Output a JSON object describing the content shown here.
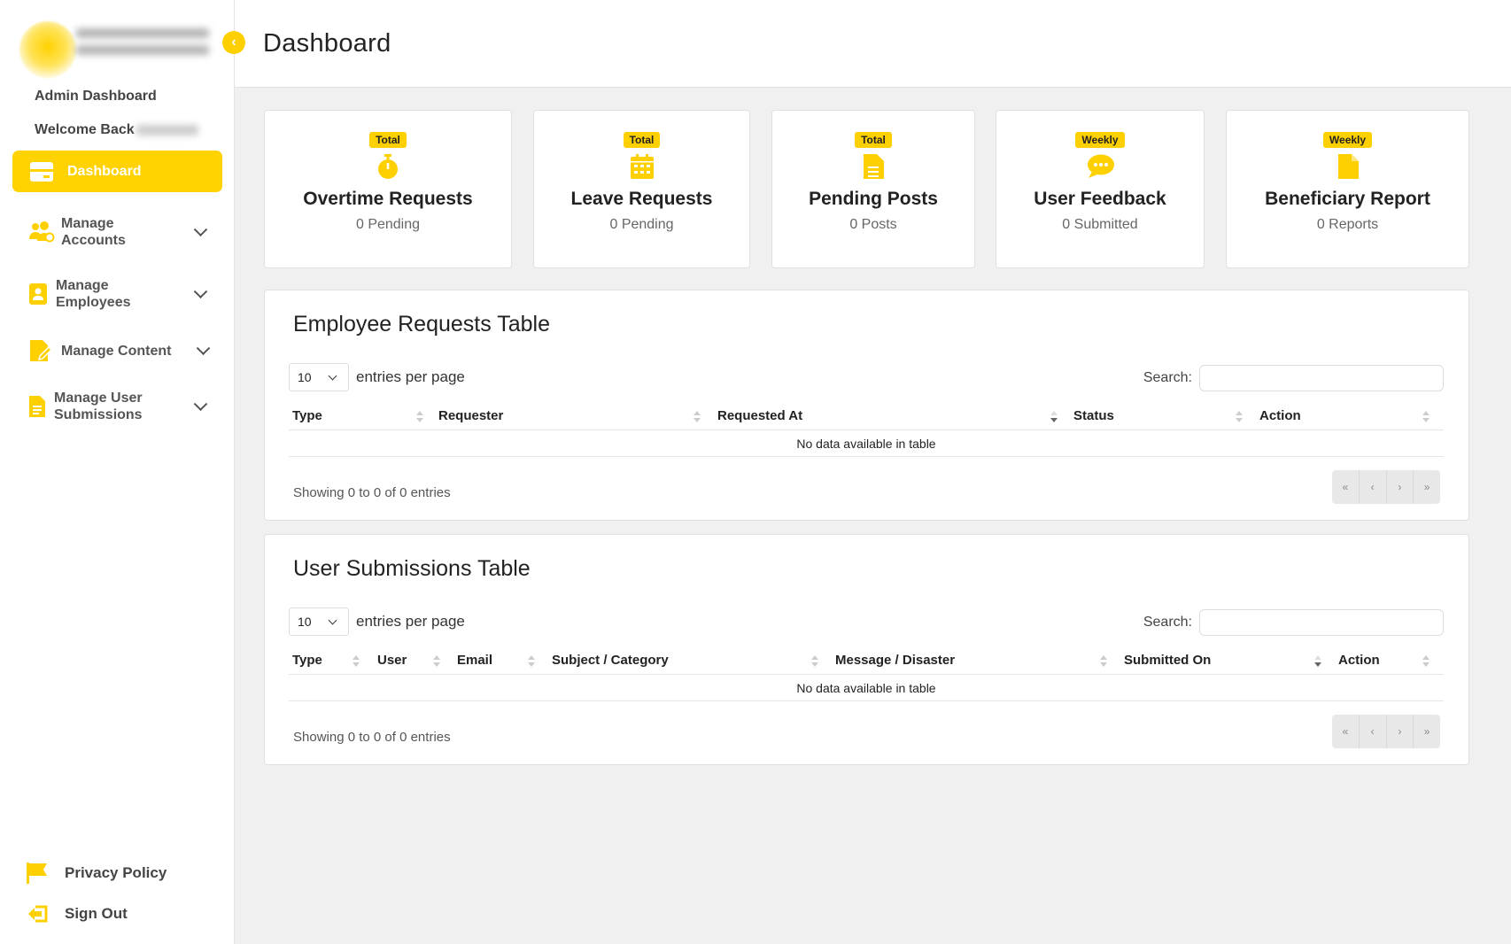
{
  "sidebar": {
    "admin_title": "Admin Dashboard",
    "welcome": "Welcome Back",
    "active_item": "Dashboard",
    "items": [
      {
        "label": "Manage Accounts",
        "icon": "users-icon"
      },
      {
        "label": "Manage Employees",
        "icon": "employee-badge-icon"
      },
      {
        "label": "Manage Content",
        "icon": "edit-document-icon"
      },
      {
        "label": "Manage User Submissions",
        "icon": "submissions-icon"
      }
    ],
    "bottom": {
      "privacy": "Privacy Policy",
      "signout": "Sign Out"
    }
  },
  "header": {
    "title": "Dashboard"
  },
  "cards": [
    {
      "badge": "Total",
      "title": "Overtime Requests",
      "sub": "0 Pending",
      "icon": "stopwatch-icon"
    },
    {
      "badge": "Total",
      "title": "Leave Requests",
      "sub": "0 Pending",
      "icon": "calendar-icon"
    },
    {
      "badge": "Total",
      "title": "Pending Posts",
      "sub": "0 Posts",
      "icon": "document-icon"
    },
    {
      "badge": "Weekly",
      "title": "User Feedback",
      "sub": "0 Submitted",
      "icon": "chat-bubble-icon"
    },
    {
      "badge": "Weekly",
      "title": "Beneficiary Report",
      "sub": "0 Reports",
      "icon": "file-icon"
    }
  ],
  "employee_table": {
    "title": "Employee Requests Table",
    "entries_value": "10",
    "entries_label": "entries per page",
    "search_label": "Search:",
    "columns": [
      "Type",
      "Requester",
      "Requested At",
      "Status",
      "Action"
    ],
    "empty": "No data available in table",
    "info": "Showing 0 to 0 of 0 entries",
    "pager": [
      "«",
      "‹",
      "›",
      "»"
    ]
  },
  "submissions_table": {
    "title": "User Submissions Table",
    "entries_value": "10",
    "entries_label": "entries per page",
    "search_label": "Search:",
    "columns": [
      "Type",
      "User",
      "Email",
      "Subject / Category",
      "Message / Disaster",
      "Submitted On",
      "Action"
    ],
    "empty": "No data available in table",
    "info": "Showing 0 to 0 of 0 entries",
    "pager": [
      "«",
      "‹",
      "›",
      "»"
    ]
  },
  "colors": {
    "accent": "#ffd000",
    "background": "#f0f0f0"
  }
}
